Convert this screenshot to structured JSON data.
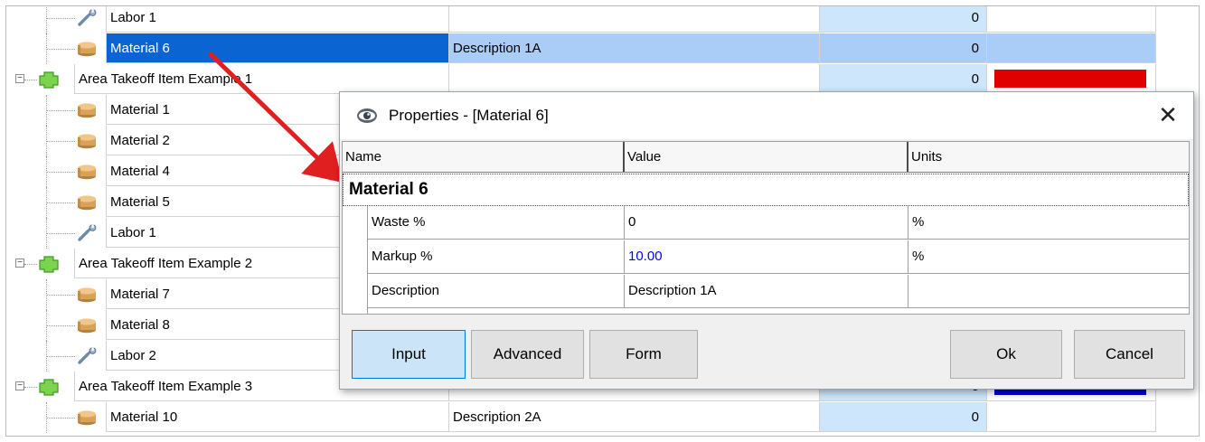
{
  "tree": {
    "rows": [
      {
        "name": "Labor 1",
        "icon": "wrench-icon",
        "desc": "",
        "qty": "0",
        "color": ""
      },
      {
        "name": "Material 6",
        "icon": "material-box-icon",
        "desc": "Description 1A",
        "qty": "0",
        "color": "",
        "selected": true
      },
      {
        "name": "Area Takeoff Item Example 1",
        "icon": "area-takeoff-icon",
        "desc": "",
        "qty": "0",
        "color": "#e00000",
        "group": true
      },
      {
        "name": "Material 1",
        "icon": "material-box-icon",
        "desc": "",
        "qty": "",
        "color": ""
      },
      {
        "name": "Material 2",
        "icon": "material-box-icon",
        "desc": "",
        "qty": "",
        "color": ""
      },
      {
        "name": "Material 4",
        "icon": "material-box-icon",
        "desc": "",
        "qty": "",
        "color": ""
      },
      {
        "name": "Material 5",
        "icon": "material-box-icon",
        "desc": "",
        "qty": "",
        "color": ""
      },
      {
        "name": "Labor 1",
        "icon": "wrench-icon",
        "desc": "",
        "qty": "",
        "color": ""
      },
      {
        "name": "Area Takeoff Item Example 2",
        "icon": "area-takeoff-icon",
        "desc": "",
        "qty": "",
        "color": "",
        "group": true
      },
      {
        "name": "Material 7",
        "icon": "material-box-icon",
        "desc": "",
        "qty": "",
        "color": ""
      },
      {
        "name": "Material 8",
        "icon": "material-box-icon",
        "desc": "",
        "qty": "",
        "color": ""
      },
      {
        "name": "Labor 2",
        "icon": "wrench-icon",
        "desc": "",
        "qty": "",
        "color": ""
      },
      {
        "name": "Area Takeoff Item Example 3",
        "icon": "area-takeoff-icon",
        "desc": "",
        "qty": "0",
        "color": "#0000d8",
        "group": true
      },
      {
        "name": "Material 10",
        "icon": "material-box-icon",
        "desc": "Description 2A",
        "qty": "0",
        "color": ""
      }
    ]
  },
  "dialog": {
    "title": "Properties - [Material 6]",
    "close_glyph": "✕",
    "columns": {
      "name": "Name",
      "value": "Value",
      "units": "Units"
    },
    "group_label": "Material 6",
    "properties": [
      {
        "name": "Waste %",
        "value": "0",
        "units": "%",
        "value_color": "#000000"
      },
      {
        "name": "Markup %",
        "value": "10.00",
        "units": "%",
        "value_color": "#0000ff"
      },
      {
        "name": "Description",
        "value": "Description 1A",
        "units": "",
        "value_color": "#000000"
      }
    ],
    "buttons": {
      "input": "Input",
      "advanced": "Advanced",
      "form": "Form",
      "ok": "Ok",
      "cancel": "Cancel"
    }
  },
  "annotation": {
    "arrow_color": "#e02020"
  }
}
